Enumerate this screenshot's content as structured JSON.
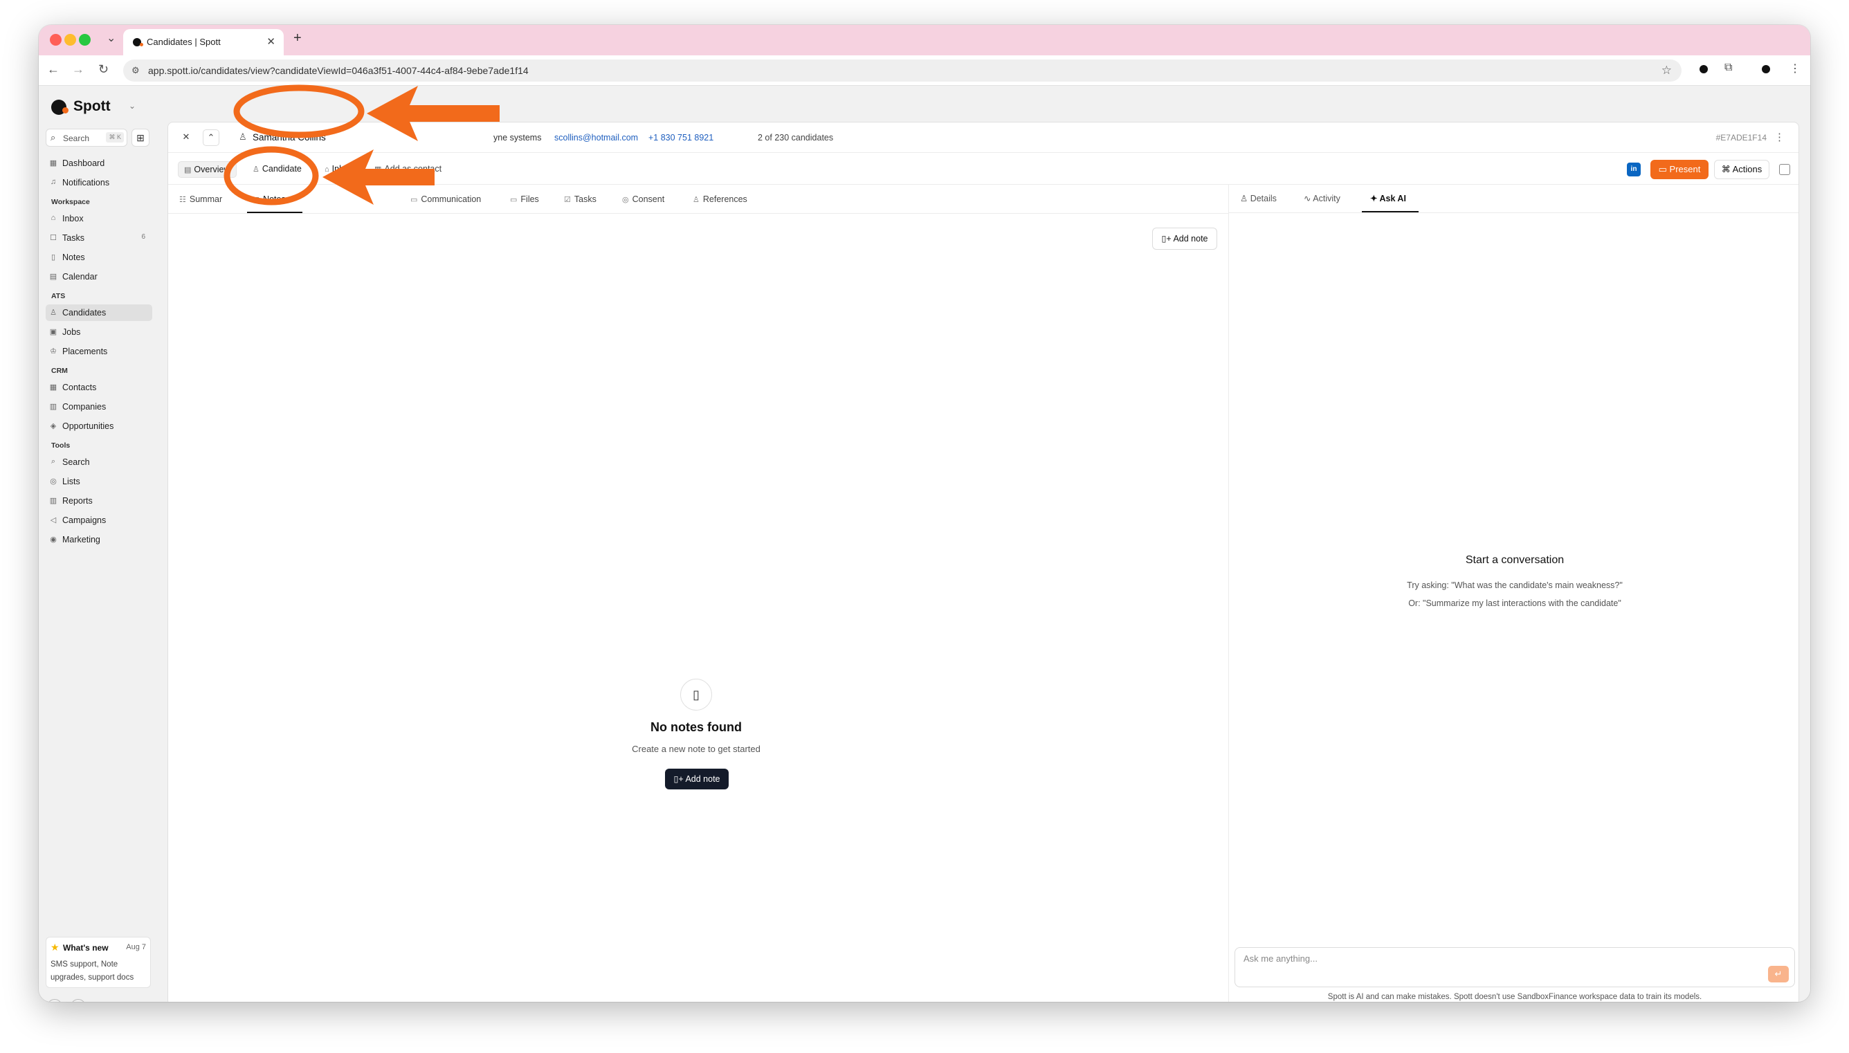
{
  "browser": {
    "tab_title": "Candidates | Spott",
    "url": "app.spott.io/candidates/view?candidateViewId=046a3f51-4007-44c4-af84-9ebe7ade1f14",
    "new_tab": "+",
    "close": "✕"
  },
  "sidebar": {
    "brand": "Spott",
    "search_label": "Search",
    "search_shortcut": "⌘ K",
    "top_items": [
      {
        "label": "Dashboard",
        "icon": "grid-icon"
      },
      {
        "label": "Notifications",
        "icon": "bell-icon"
      }
    ],
    "sections": [
      {
        "label": "Workspace"
      },
      {
        "label": "ATS"
      },
      {
        "label": "CRM"
      },
      {
        "label": "Tools"
      }
    ],
    "workspace_items": [
      {
        "label": "Inbox"
      },
      {
        "label": "Tasks",
        "count": "6"
      },
      {
        "label": "Notes"
      },
      {
        "label": "Calendar"
      }
    ],
    "ats_items": [
      {
        "label": "Candidates"
      },
      {
        "label": "Jobs"
      },
      {
        "label": "Placements"
      }
    ],
    "crm_items": [
      {
        "label": "Contacts"
      },
      {
        "label": "Companies"
      },
      {
        "label": "Opportunities"
      }
    ],
    "tools_items": [
      {
        "label": "Search"
      },
      {
        "label": "Lists"
      },
      {
        "label": "Reports"
      },
      {
        "label": "Campaigns"
      },
      {
        "label": "Marketing"
      }
    ],
    "whats_new": {
      "title": "What's new",
      "date": "Aug 7",
      "body": "SMS support, Note upgrades, support docs"
    }
  },
  "header": {
    "candidate_name": "Samantha Collins",
    "company_fragment": "yne systems",
    "email": "scollins@hotmail.com",
    "phone": "+1 830 751 8921",
    "position": "2 of 230 candidates",
    "record_id": "#E7ADE1F14"
  },
  "subnav": {
    "overview": "Overview",
    "candidate": "Candidate",
    "inbox": "Inbox",
    "add_contact": "Add as contact",
    "linkedin": "in",
    "present": "Present",
    "actions": "Actions"
  },
  "tabs": {
    "summary": "Summar",
    "notes": "Notes",
    "communication": "Communication",
    "files": "Files",
    "tasks": "Tasks",
    "consent": "Consent",
    "references": "References"
  },
  "notes": {
    "add_note_top": "Add note",
    "empty_title": "No notes found",
    "empty_subtitle": "Create a new note to get started",
    "add_note_main": "Add note"
  },
  "right_panel": {
    "tab_details": "Details",
    "tab_activity": "Activity",
    "tab_ask_ai": "Ask AI",
    "conversation_title": "Start a conversation",
    "suggestion_1": "Try asking: \"What was the candidate's main weakness?\"",
    "suggestion_2": "Or: \"Summarize my last interactions with the candidate\"",
    "input_placeholder": "Ask me anything...",
    "disclaimer": "Spott is AI and can make mistakes. Spott doesn't use SandboxFinance workspace data to train its models."
  },
  "colors": {
    "accent": "#f26a1b",
    "tabstrip": "#f6d2e0",
    "annotation": "#f26a1b"
  }
}
